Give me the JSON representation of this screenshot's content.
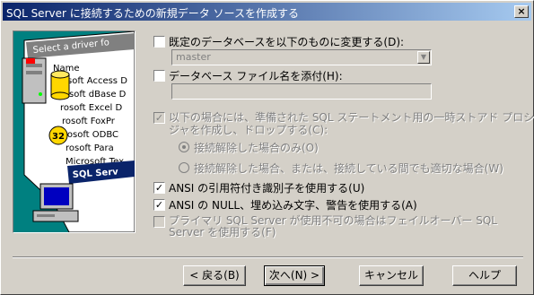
{
  "window": {
    "title": "SQL Server に接続するための新規データ ソースを作成する",
    "close_glyph": "×"
  },
  "options": {
    "change_db": {
      "label": "既定のデータベースを以下のものに変更する(D):",
      "checked": false
    },
    "db_combo": {
      "value": "master"
    },
    "attach_file": {
      "label": "データベース ファイル名を添付(H):",
      "checked": false
    },
    "attach_value": "",
    "temp_sp": {
      "label_line1": "以下の場合には、準備された SQL ステートメント用の一時ストアド プロシー",
      "label_line2": "ジャを作成し、ドロップする(C):",
      "checked": true,
      "enabled": false
    },
    "radio_disconnect": {
      "label": "接続解除した場合のみ(O)",
      "selected": true
    },
    "radio_disconnect_or": {
      "label": "接続解除した場合、または、接続している間でも適切な場合(W)",
      "selected": false
    },
    "ansi_quoted": {
      "label": "ANSI の引用符付き識別子を使用する(U)",
      "checked": true
    },
    "ansi_nulls": {
      "label": "ANSI の NULL、埋め込み文字、警告を使用する(A)",
      "checked": true
    },
    "failover": {
      "label_line1": "プライマリ SQL Server が使用不可の場合はフェイルオーバー SQL",
      "label_line2": "Server を使用する(F)",
      "checked": false,
      "enabled": false
    }
  },
  "illustration": {
    "header": "Select a driver fo",
    "col": "Name",
    "items": [
      "rosoft Access D",
      "rosoft dBase D",
      "rosoft Excel D",
      "rosoft FoxPr",
      "rosoft ODBC",
      "rosoft Para",
      "Microsoft Tex",
      "SQL Serv"
    ],
    "badge": "32"
  },
  "buttons": {
    "back": "< 戻る(B)",
    "next": "次へ(N) >",
    "cancel": "キャンセル",
    "help": "ヘルプ"
  }
}
